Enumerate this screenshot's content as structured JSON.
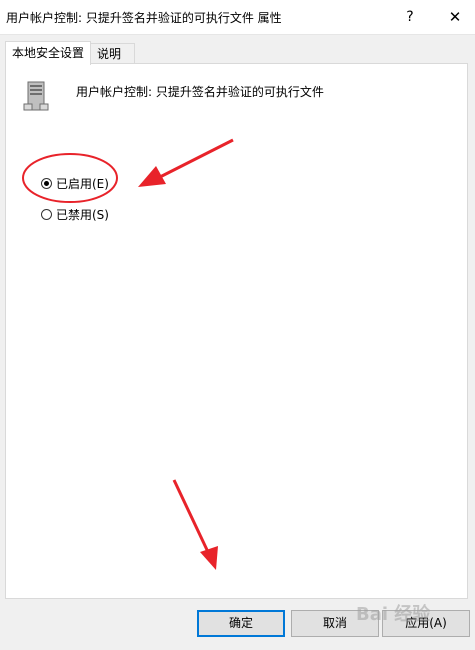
{
  "window": {
    "title": "用户帐户控制: 只提升签名并验证的可执行文件 属性",
    "help_label": "?",
    "close_label": "✕"
  },
  "tabs": [
    {
      "label": "本地安全设置",
      "active": true
    },
    {
      "label": "说明",
      "active": false
    }
  ],
  "policy": {
    "icon": "server-policy-icon",
    "name": "用户帐户控制: 只提升签名并验证的可执行文件"
  },
  "options": [
    {
      "label": "已启用(E)",
      "checked": true
    },
    {
      "label": "已禁用(S)",
      "checked": false
    }
  ],
  "buttons": {
    "ok": "确定",
    "cancel": "取消",
    "apply": "应用(A)"
  },
  "watermark": "Bai 经验",
  "colors": {
    "annotation": "#e8232a",
    "default_button_border": "#0078d7"
  }
}
